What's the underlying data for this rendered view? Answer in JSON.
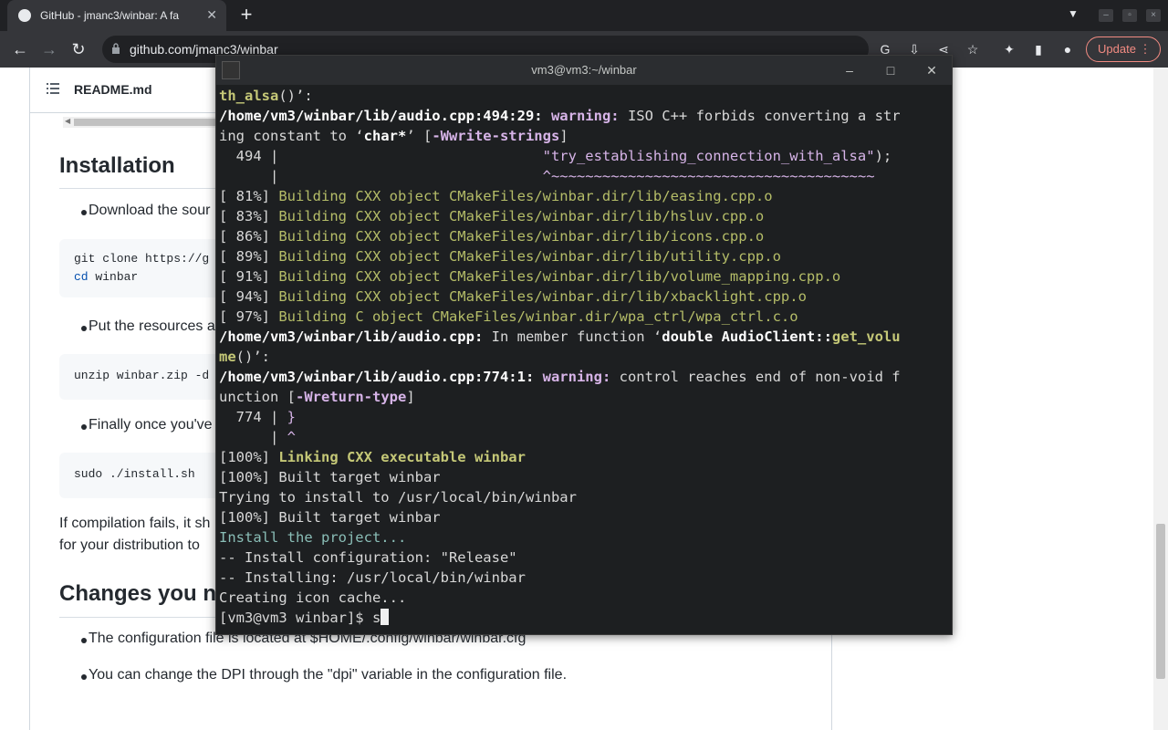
{
  "browser": {
    "tab_title": "GitHub - jmanc3/winbar: A fa",
    "tab_close": "✕",
    "new_tab": "+",
    "url": "github.com/jmanc3/winbar",
    "update_label": "Update"
  },
  "readme": {
    "file_name": "README.md",
    "installation_heading": "Installation",
    "install_items": [
      "Download the sour",
      "Put the resources a",
      "Finally once you've"
    ],
    "code1_line1": "git clone https://g",
    "code1_line2_kw": "cd",
    "code1_line2_rest": " winbar",
    "code2": "unzip winbar.zip -d",
    "code3": "sudo ./install.sh",
    "compile_note_1": "If compilation fails, it sh",
    "compile_note_2": "for your distribution to",
    "changes_heading": "Changes you n",
    "changes_items": [
      "The configuration file is located at $HOME/.config/winbar/winbar.cfg",
      "You can change the DPI through the \"dpi\" variable in the configuration file."
    ]
  },
  "terminal": {
    "title": "vm3@vm3:~/winbar",
    "prompt": "[vm3@vm3 winbar]$ ",
    "typed": "s"
  },
  "colors": {
    "terminal_bg": "#1d1f21",
    "browser_chrome": "#35363a",
    "update_accent": "#f28b82"
  }
}
